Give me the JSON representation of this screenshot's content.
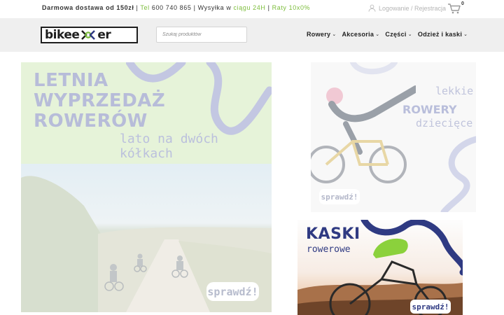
{
  "topbar": {
    "delivery": "Darmowa dostawa od 150zł",
    "sep1": " | ",
    "tel_label": "Tel",
    "tel_number": " 600 740 865",
    "sep2": " | ",
    "shipping_label": "Wysyłka w ",
    "shipping_time": "ciągu 24H",
    "sep3": " | ",
    "installments": "Raty 10x0%",
    "account_link": "Logowanie / Rejestracja",
    "cart_count": "0"
  },
  "header": {
    "logo_left": "bikee",
    "logo_right": "er",
    "search_placeholder": "Szukaj produktów",
    "menu": [
      {
        "label": "Rowery"
      },
      {
        "label": "Akcesoria"
      },
      {
        "label": "Części"
      },
      {
        "label": "Odzież i kaski"
      }
    ]
  },
  "banners": {
    "summer_sale": {
      "title_line1": "LETNIA",
      "title_line2": "WYPRZEDAŻ",
      "title_line3": "ROWERÓW",
      "subtitle": "lato na dwóch kółkach",
      "cta": "sprawdź!"
    },
    "kids_bikes": {
      "line1": "lekkie",
      "line2": "ROWERY",
      "line3": "dziecięce",
      "cta": "sprawdź!"
    },
    "helmets": {
      "line1": "KASKI",
      "line2": "rowerowe",
      "cta": "sprawdź!"
    }
  },
  "colors": {
    "accent_green": "#7cbd3b",
    "navy": "#2f3a82",
    "lavender": "#b7bcd9",
    "nav_bg": "#efefef"
  }
}
